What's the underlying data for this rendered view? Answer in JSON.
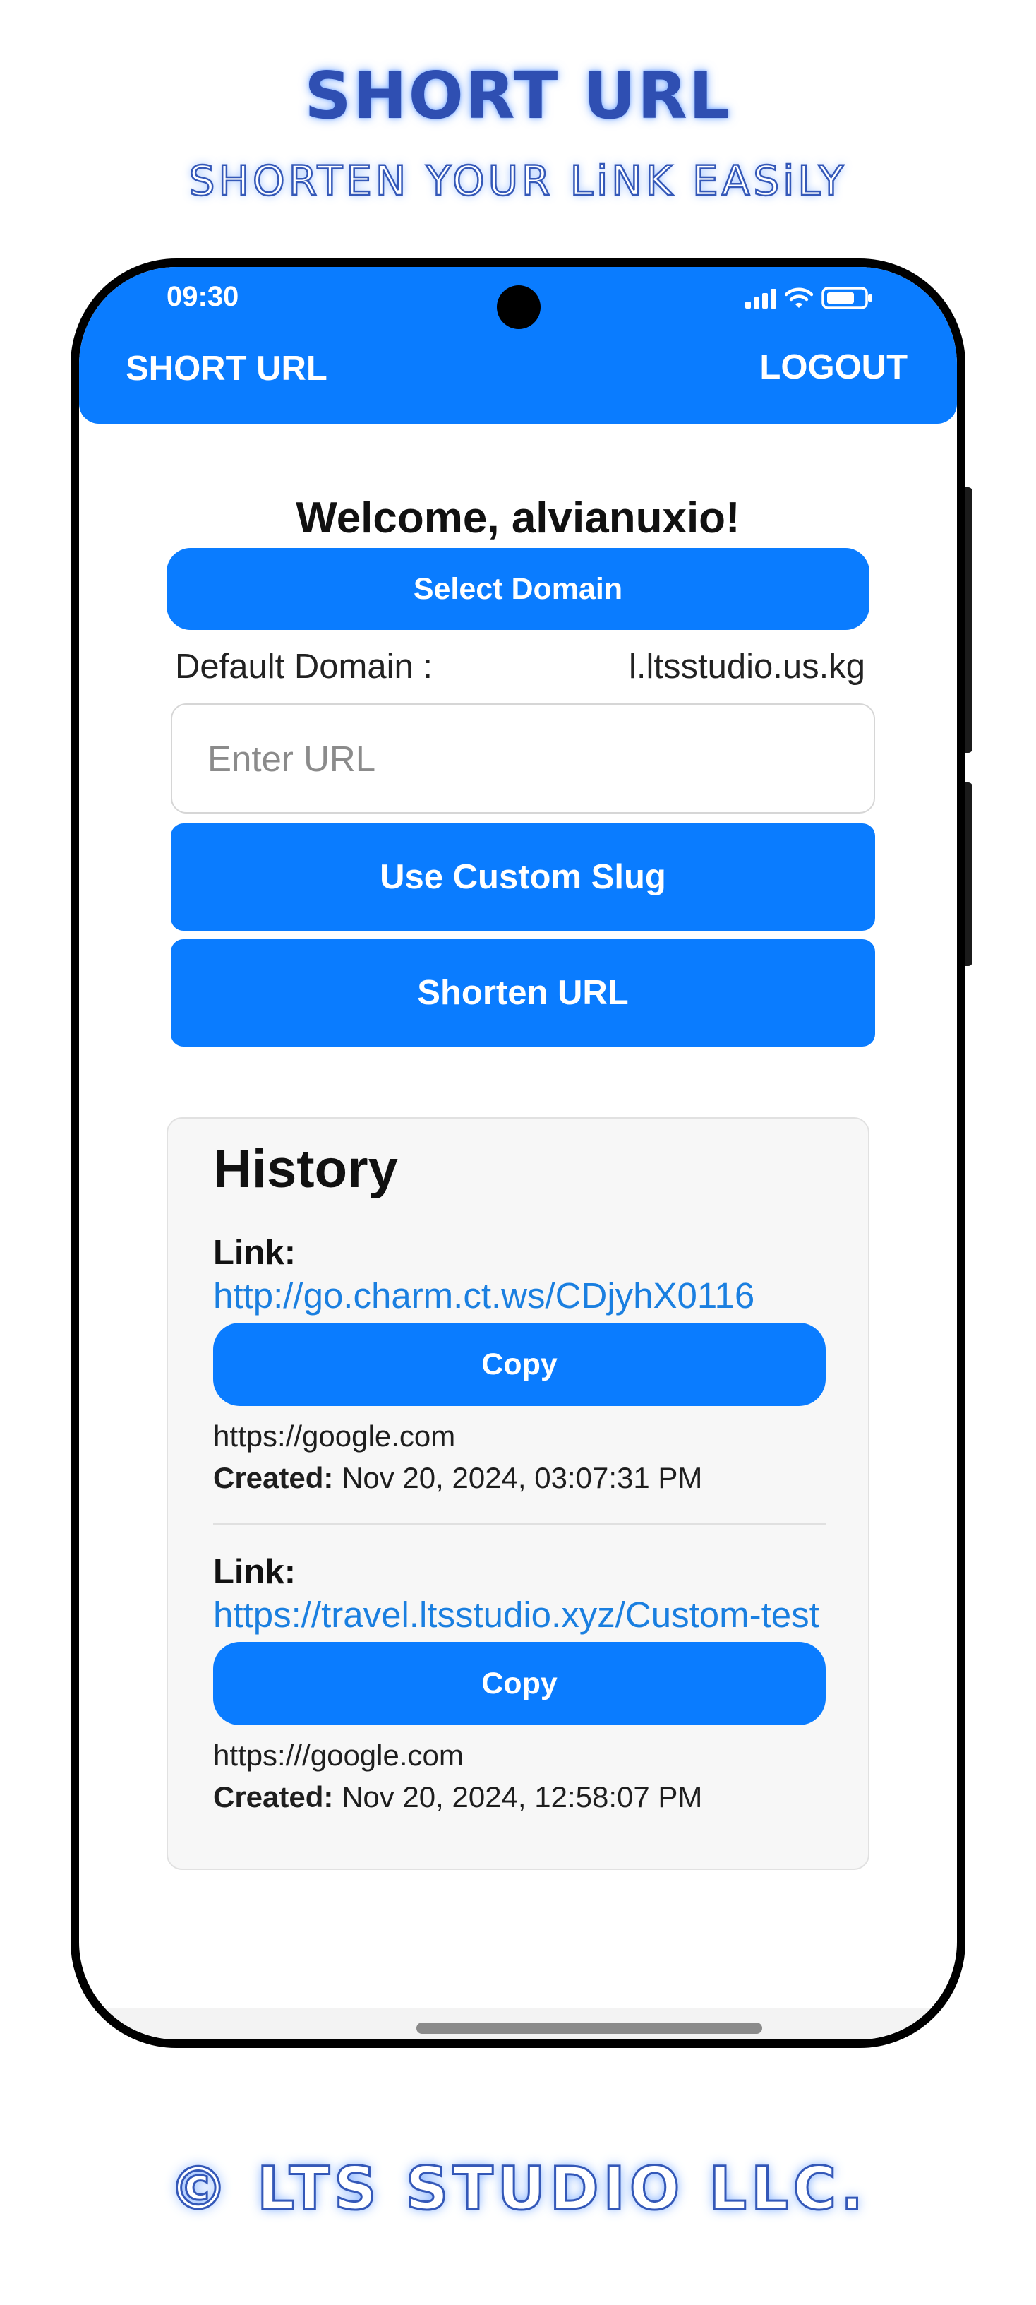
{
  "promo": {
    "title": "SHORT URL",
    "subtitle": "SHORTEN YOUR LiNK EASiLY",
    "footer": "© LTS STUDIO LLC."
  },
  "status_bar": {
    "time": "09:30",
    "icons": [
      "signal-icon",
      "wifi-icon",
      "battery-icon"
    ]
  },
  "app_bar": {
    "title": "SHORT URL",
    "logout_label": "LOGOUT"
  },
  "main": {
    "welcome": "Welcome, alvianuxio!",
    "select_domain_label": "Select Domain",
    "default_domain_label": "Default Domain :",
    "default_domain_value": "l.ltsstudio.us.kg",
    "url_input": {
      "placeholder": "Enter URL",
      "value": ""
    },
    "custom_slug_label": "Use Custom Slug",
    "shorten_label": "Shorten URL"
  },
  "history": {
    "title": "History",
    "items": [
      {
        "link_label": "Link:",
        "link": "http://go.charm.ct.ws/CDjyhX0116",
        "copy_label": "Copy",
        "original_url": "https://google.com",
        "created_label": "Created:",
        "created_value": "Nov 20, 2024, 03:07:31 PM"
      },
      {
        "link_label": "Link:",
        "link": "https://travel.ltsstudio.xyz/Custom-test",
        "copy_label": "Copy",
        "original_url": "https:///google.com",
        "created_label": "Created:",
        "created_value": "Nov 20, 2024, 12:58:07 PM"
      }
    ]
  },
  "colors": {
    "primary": "#0a7cff",
    "link": "#1a7fe0",
    "promo_blue": "#2f4fb2"
  }
}
